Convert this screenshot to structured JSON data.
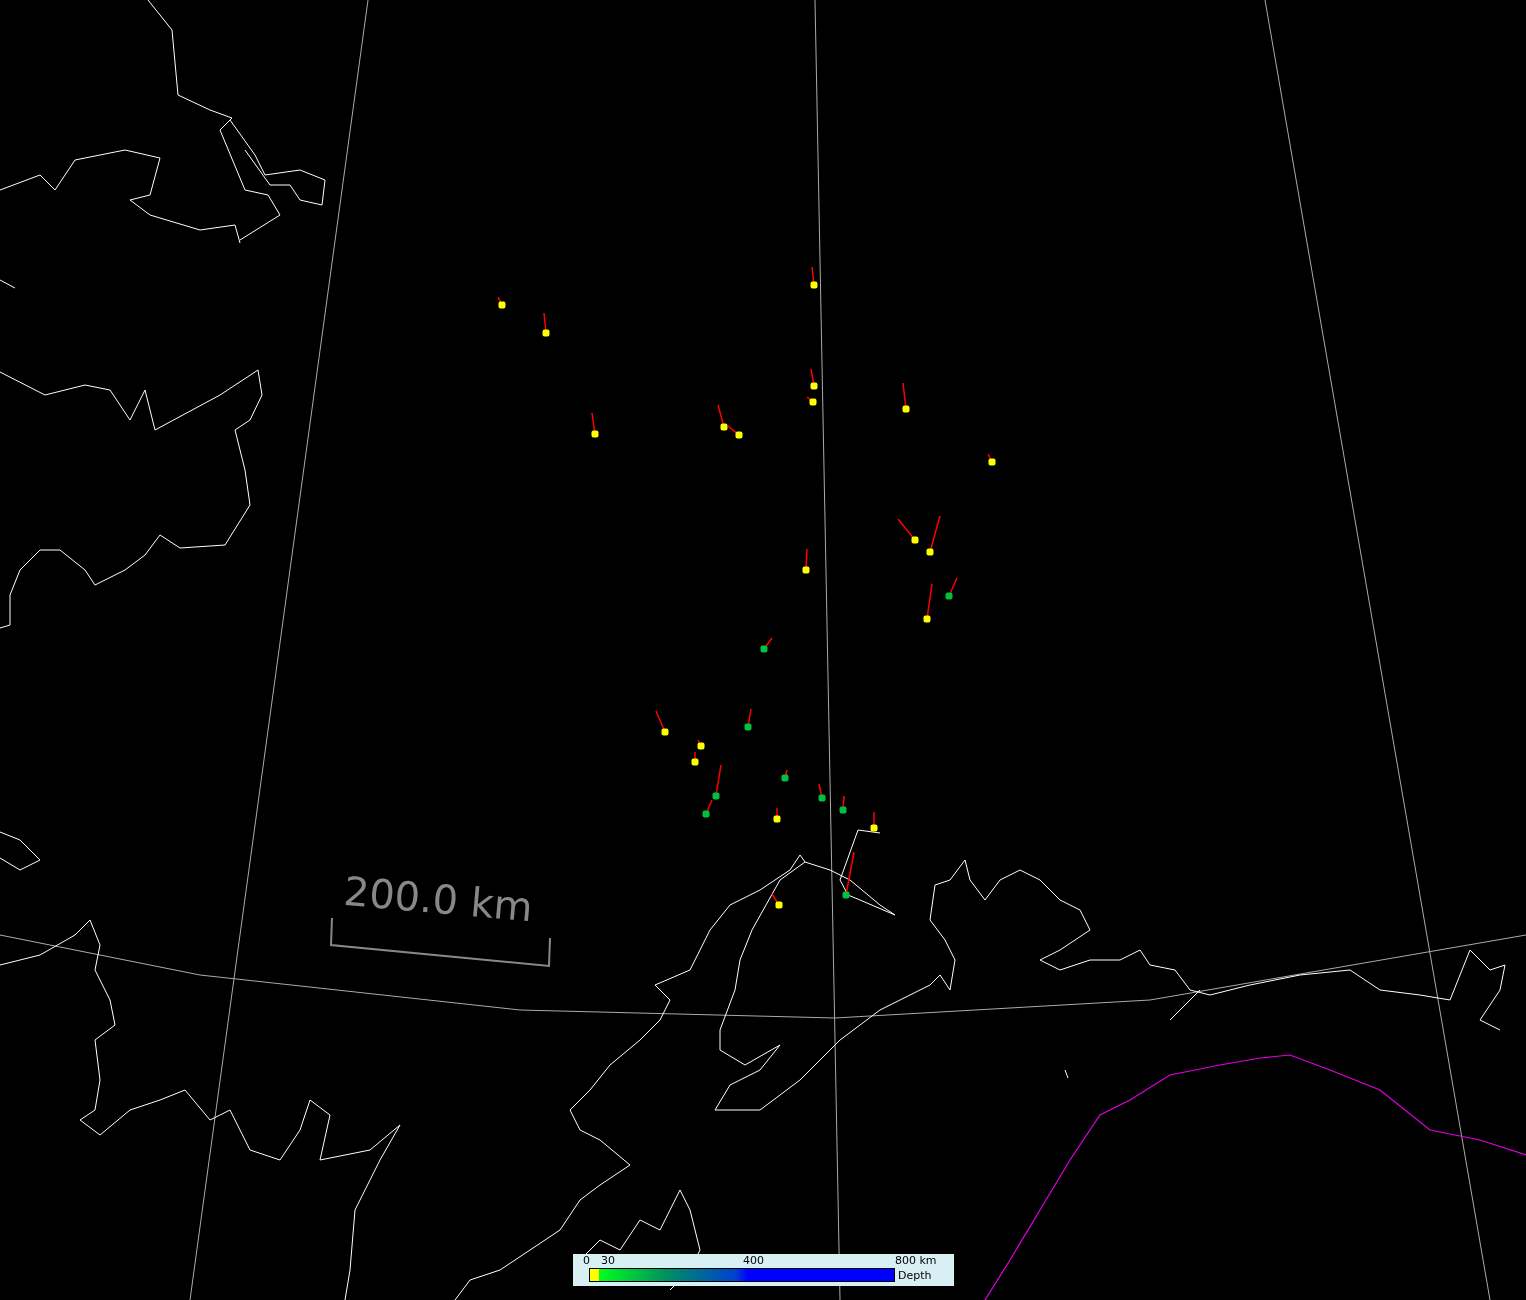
{
  "scale_bar": {
    "label": "200.0 km"
  },
  "events": [
    {
      "color": "#ffff00"
    },
    {
      "color": "#ffff00"
    },
    {
      "color": "#ffff00"
    },
    {
      "color": "#ffff00"
    },
    {
      "color": "#ffff00"
    },
    {
      "color": "#ffff00"
    },
    {
      "color": "#ffff00"
    },
    {
      "color": "#ffff00"
    },
    {
      "color": "#ffff00"
    },
    {
      "color": "#ffff00"
    },
    {
      "color": "#ffff00"
    },
    {
      "color": "#ffff00"
    },
    {
      "color": "#ffff00"
    },
    {
      "color": "#00c040"
    },
    {
      "color": "#ffff00"
    },
    {
      "color": "#00c040"
    },
    {
      "color": "#ffff00"
    },
    {
      "color": "#00c040"
    },
    {
      "color": "#ffff00"
    },
    {
      "color": "#ffff00"
    },
    {
      "color": "#00c040"
    },
    {
      "color": "#00c040"
    },
    {
      "color": "#00c040"
    },
    {
      "color": "#00c040"
    },
    {
      "color": "#00c040"
    },
    {
      "color": "#ffff00"
    },
    {
      "color": "#ffff00"
    },
    {
      "color": "#00c040"
    },
    {
      "color": "#ffff00"
    }
  ],
  "legend": {
    "ticks": [
      "0",
      "30",
      "400",
      "800 km"
    ],
    "label": "Depth"
  }
}
